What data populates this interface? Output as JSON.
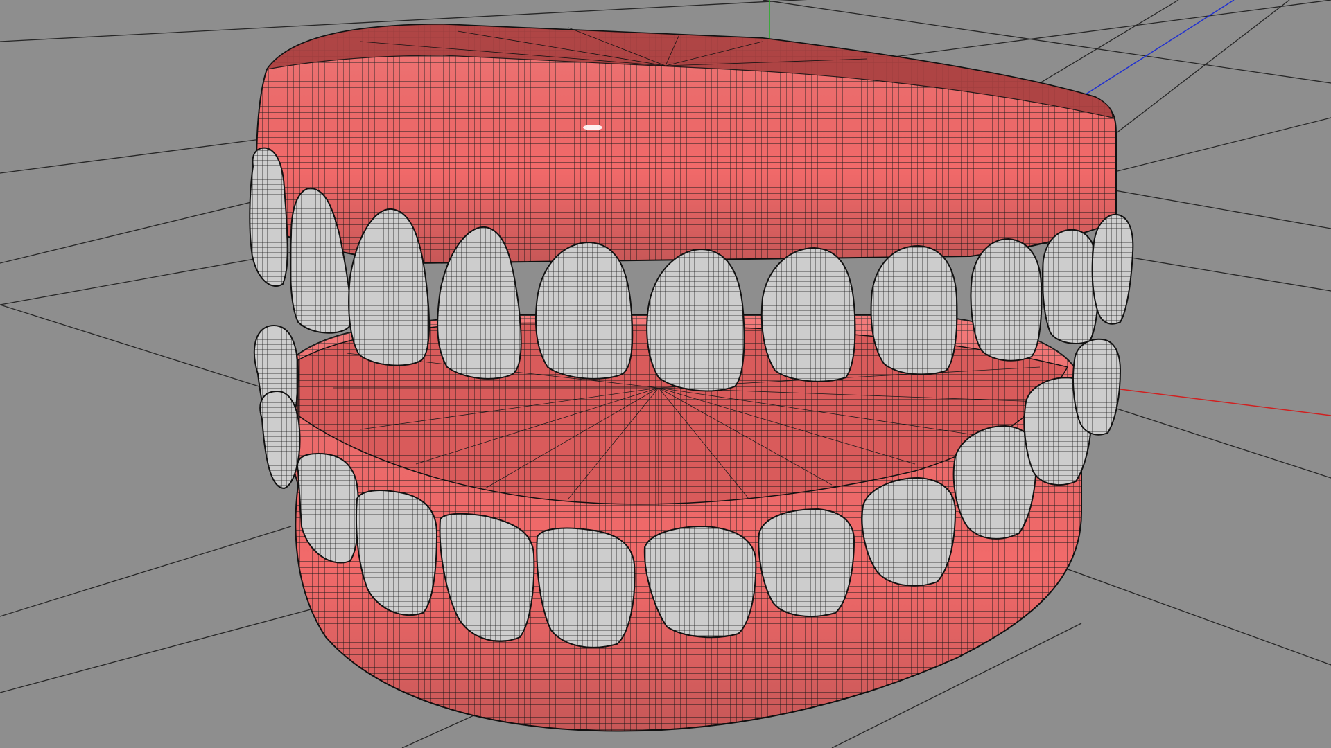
{
  "viewport": {
    "background": "#8e8e8e",
    "grid_color": "#262626",
    "axis_colors": {
      "x": "#d02020",
      "y": "#20b020",
      "z": "#2030d0"
    }
  },
  "model": {
    "gum_color": "#f26a6a",
    "gum_shadow_color": "#b84a4a",
    "tooth_color": "#c9c9c9",
    "wire_color": "#1a1a1a",
    "display_mode": "wireframe-on-shaded"
  }
}
